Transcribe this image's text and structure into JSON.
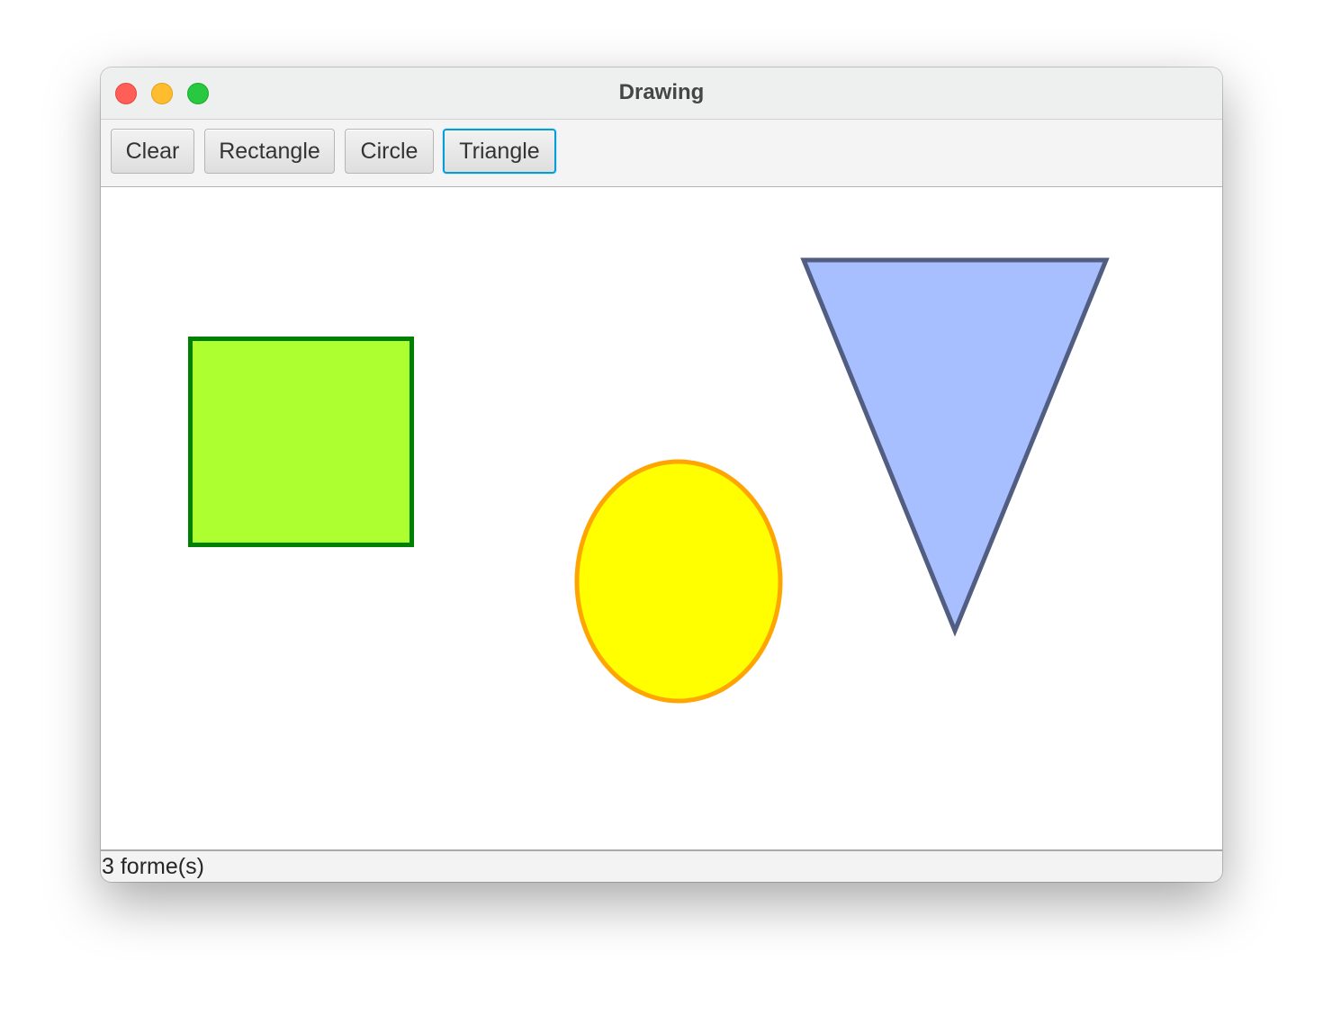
{
  "window": {
    "title": "Drawing"
  },
  "toolbar": {
    "buttons": [
      {
        "label": "Clear",
        "focused": false
      },
      {
        "label": "Rectangle",
        "focused": false
      },
      {
        "label": "Circle",
        "focused": false
      },
      {
        "label": "Triangle",
        "focused": true
      }
    ],
    "focus_color": "#039ed3"
  },
  "canvas": {
    "background": "#ffffff",
    "shapes": [
      {
        "type": "rectangle",
        "fill": "#adff2f",
        "stroke": "#008000"
      },
      {
        "type": "ellipse",
        "fill": "#ffff00",
        "stroke": "#ffa500"
      },
      {
        "type": "triangle",
        "fill": "#a8bfff",
        "stroke": "#515e82"
      }
    ]
  },
  "status": {
    "text": "3 forme(s)"
  }
}
